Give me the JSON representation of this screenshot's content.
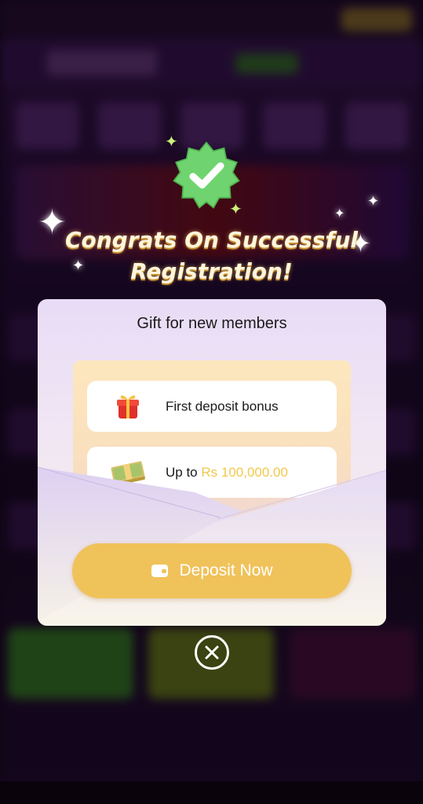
{
  "congrats": {
    "line1": "Congrats On Successful",
    "line2": "Registration!"
  },
  "modal": {
    "title": "Gift for new members",
    "items": [
      {
        "label": "First deposit bonus",
        "icon": "gift-icon"
      },
      {
        "prefix": "Up to ",
        "amount": "Rs 100,000.00",
        "icon": "money-stack-icon"
      }
    ],
    "deposit_button": {
      "label": "Deposit Now",
      "icon": "wallet-icon"
    },
    "close_icon": "close-icon"
  },
  "colors": {
    "accent": "#f0c25a",
    "amount": "#f2c84b",
    "badge": "#6fd46f",
    "title_text": "#fff6dc"
  }
}
